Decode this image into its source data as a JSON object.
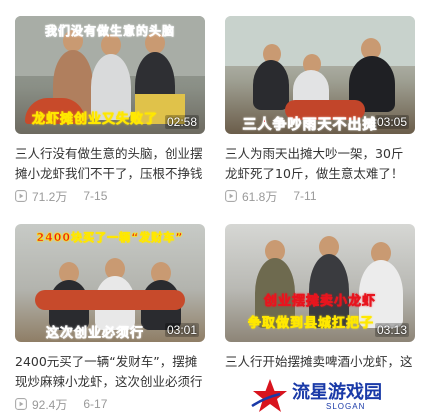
{
  "videos": [
    {
      "overlay_top": "我们没有做生意的头脑",
      "overlay_bottom": "龙虾摊创业又失败了",
      "duration": "02:58",
      "title": "三人行没有做生意的头脑，创业摆摊小龙虾我们不干了，压根不挣钱",
      "views": "71.2万",
      "date": "7-15"
    },
    {
      "overlay_top": "",
      "overlay_bottom": "三人争吵雨天不出摊",
      "duration": "03:05",
      "title": "三人为雨天出摊大吵一架，30斤龙虾死了10斤，做生意太难了！",
      "views": "61.8万",
      "date": "7-11"
    },
    {
      "overlay_top": "2400块买了一辆“发财车”",
      "overlay_bottom": "这次创业必须行",
      "duration": "03:01",
      "title": "2400元买了一辆“发财车”，摆摊现炒麻辣小龙虾，这次创业必须行",
      "views": "92.4万",
      "date": "6-17"
    },
    {
      "overlay_top": "创业摆摊卖小龙虾",
      "overlay_bottom": "争取做到县城扛把子",
      "duration": "03:13",
      "title": "三人行开始摆摊卖啤酒小龙虾，这",
      "views": "",
      "date": ""
    }
  ],
  "watermark": {
    "text": "流星游戏园",
    "slogan": "SLOGAN"
  },
  "colors": {
    "overlay_yellow": "#ffe800",
    "overlay_red": "#e8141e",
    "overlay_blue": "#1c3fd0",
    "meta_gray": "#999999"
  }
}
